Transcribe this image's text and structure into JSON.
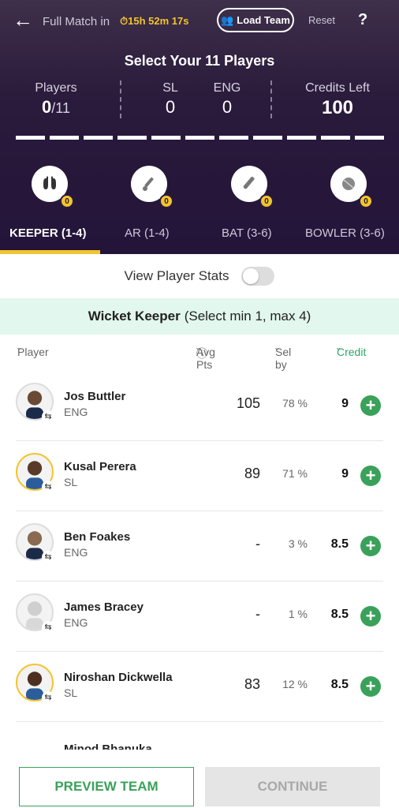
{
  "header": {
    "match_label": "Full Match",
    "in_label": "in",
    "timer": "15h 52m 17s",
    "load_team": "Load Team",
    "reset": "Reset",
    "help": "?",
    "title": "Select Your 11 Players",
    "players_label": "Players",
    "players_count": "0",
    "players_total": "/11",
    "team1": "SL",
    "team1_count": "0",
    "team2": "ENG",
    "team2_count": "0",
    "credits_label": "Credits Left",
    "credits_value": "100",
    "slots_filled": 0,
    "roles": [
      {
        "icon": "gloves-icon",
        "count": "0"
      },
      {
        "icon": "allrounder-icon",
        "count": "0"
      },
      {
        "icon": "bat-icon",
        "count": "0"
      },
      {
        "icon": "ball-icon",
        "count": "0"
      }
    ],
    "tabs": [
      "KEEPER (1-4)",
      "AR (1-4)",
      "BAT (3-6)",
      "BOWLER (3-6)"
    ]
  },
  "stats_toggle": {
    "label": "View Player Stats",
    "on": false
  },
  "section": {
    "title": "Wicket Keeper",
    "subtitle": "(Select min 1, max 4)"
  },
  "columns": {
    "player": "Player",
    "avg_pts": "Avg Pts",
    "sel_by": "Sel by",
    "credit": "Credit"
  },
  "players": [
    {
      "name": "Jos Buttler",
      "team": "ENG",
      "pts": "105",
      "sel": "78 %",
      "credit": "9"
    },
    {
      "name": "Kusal Perera",
      "team": "SL",
      "pts": "89",
      "sel": "71 %",
      "credit": "9"
    },
    {
      "name": "Ben Foakes",
      "team": "ENG",
      "pts": "-",
      "sel": "3 %",
      "credit": "8.5"
    },
    {
      "name": "James Bracey",
      "team": "ENG",
      "pts": "-",
      "sel": "1 %",
      "credit": "8.5"
    },
    {
      "name": "Niroshan Dickwella",
      "team": "SL",
      "pts": "83",
      "sel": "12 %",
      "credit": "8.5"
    }
  ],
  "partial_player": "Minod Bhanuka",
  "footer": {
    "preview": "PREVIEW TEAM",
    "continue": "CONTINUE"
  },
  "colors": {
    "accent": "#3aa15a",
    "highlight": "#f4c430",
    "header_bg": "#2a1a3b",
    "section_bg": "#e2f7ee"
  }
}
